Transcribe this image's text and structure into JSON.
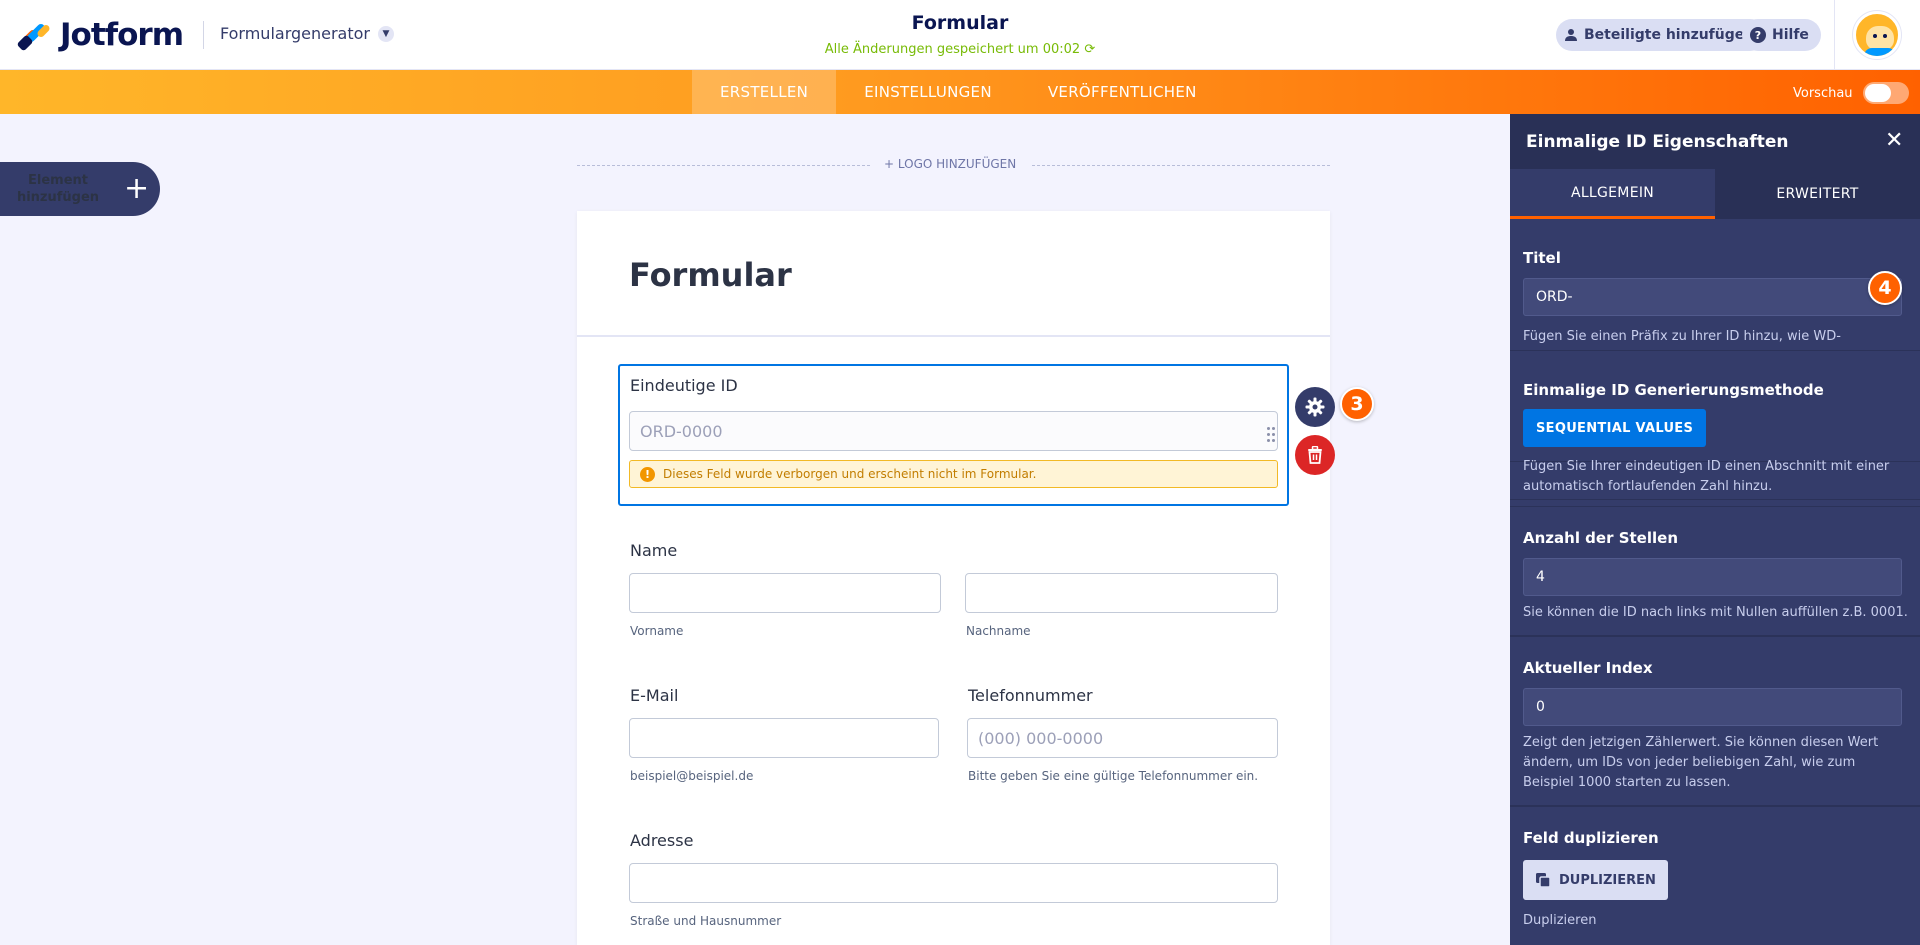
{
  "header": {
    "brand": "Jotform",
    "form_builder_label": "Formulargenerator",
    "form_title": "Formular",
    "save_status": "Alle Änderungen gespeichert um 00:02 ⟳",
    "share_button": "Beteiligte hinzufügen",
    "help_button": "Hilfe"
  },
  "nav": {
    "tabs": [
      "ERSTELLEN",
      "EINSTELLUNGEN",
      "VERÖFFENTLICHEN"
    ],
    "active_tab": "ERSTELLEN",
    "preview_label": "Vorschau",
    "preview_on": false
  },
  "sidebar": {
    "add_element_label": "Element hinzufügen"
  },
  "canvas": {
    "logo_placeholder": "+ LOGO HINZUFÜGEN",
    "form_heading": "Formular",
    "unique_id": {
      "label": "Eindeutige ID",
      "placeholder": "ORD-0000",
      "warning": "Dieses Feld wurde verborgen und erscheint nicht im Formular."
    },
    "name": {
      "label": "Name",
      "first_sublabel": "Vorname",
      "last_sublabel": "Nachname"
    },
    "email": {
      "label": "E-Mail",
      "sublabel": "beispiel@beispiel.de"
    },
    "phone": {
      "label": "Telefonnummer",
      "placeholder": "(000) 000-0000",
      "sublabel": "Bitte geben Sie eine gültige Telefonnummer ein."
    },
    "address": {
      "label": "Adresse",
      "sublabel": "Straße und Hausnummer"
    }
  },
  "step_badges": [
    "3",
    "4"
  ],
  "panel": {
    "title": "Einmalige ID Eigenschaften",
    "tabs": [
      "ALLGEMEIN",
      "ERWEITERT"
    ],
    "active_tab": "ALLGEMEIN",
    "title_field": {
      "label": "Titel",
      "value": "ORD-",
      "help": "Fügen Sie einen Präfix zu Ihrer ID hinzu, wie WD-"
    },
    "method": {
      "label": "Einmalige ID Generierungsmethode",
      "button": "SEQUENTIAL VALUES",
      "help": "Fügen Sie Ihrer eindeutigen ID einen Abschnitt mit einer automatisch fortlaufenden Zahl hinzu."
    },
    "digits": {
      "label": "Anzahl der Stellen",
      "value": "4",
      "help": "Sie können die ID nach links mit Nullen auffüllen z.B. 0001."
    },
    "current_index": {
      "label": "Aktueller Index",
      "value": "0",
      "help": "Zeigt den jetzigen Zählerwert. Sie können diesen Wert ändern, um IDs von jeder beliebigen Zahl, wie zum Beispiel 1000 starten zu lassen."
    },
    "duplicate": {
      "label": "Feld duplizieren",
      "button": "DUPLIZIEREN",
      "help": "Duplizieren"
    }
  },
  "colors": {
    "accent_orange": "#ff6100",
    "nav_yellow": "#ffb629",
    "selection_blue": "#0075e3",
    "panel_bg": "#343c6a",
    "delete_red": "#dc2626"
  }
}
